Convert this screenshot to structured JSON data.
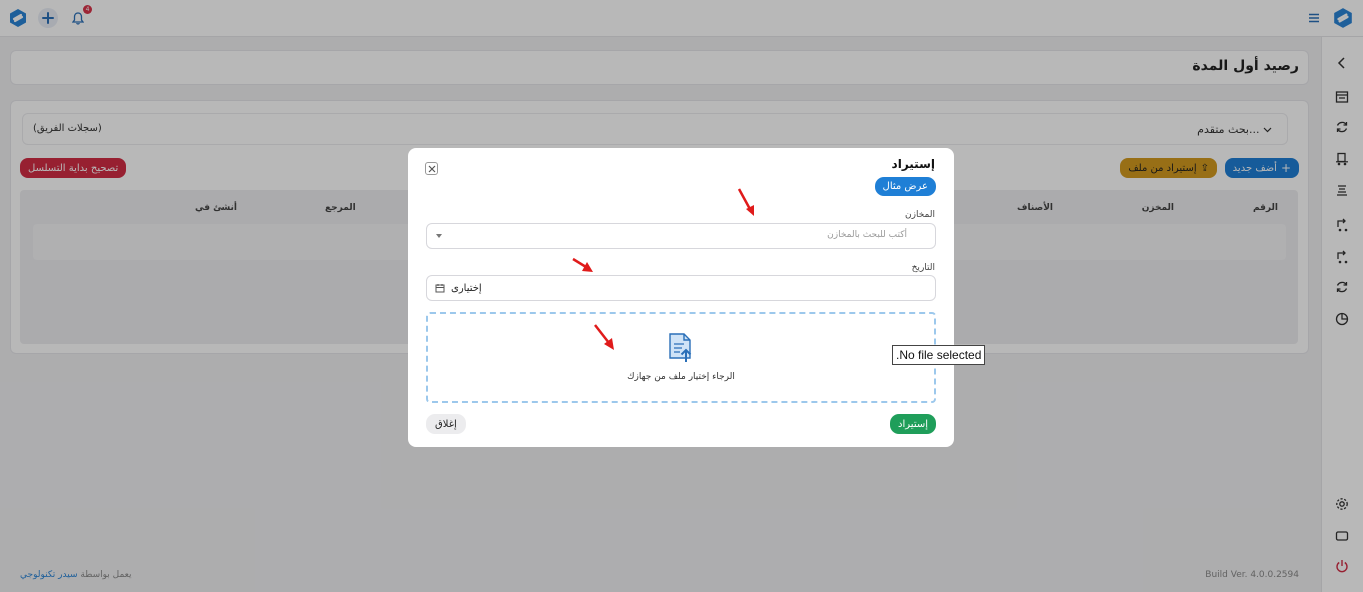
{
  "header": {
    "notification_count": "4",
    "brand_color": "#2a84d6"
  },
  "page": {
    "title": "رصيد أول المدة"
  },
  "toolbar": {
    "advanced_search": "بحث متقدم...",
    "team_records": "(سجلات الفريق)",
    "add_new": "أضف جديد",
    "import_from_file": "إستيراد من ملف",
    "fix_sequence_start": "تصحيح بداية التسلسل"
  },
  "table": {
    "columns": [
      "الرقم",
      "المخزن",
      "الأصناف",
      "المرجع",
      "أنشئ في"
    ]
  },
  "footer": {
    "powered_by": "يعمل بواسطة",
    "company": "سيدر تكنولوجي",
    "build_version": "Build Ver. 4.0.0.2594"
  },
  "modal": {
    "title": "إستيراد",
    "show_sample": "عرض مثال",
    "warehouses_label": "المخازن",
    "warehouses_placeholder": "أكتب للبحث بالمخازن",
    "date_label": "التاريخ",
    "date_value": "إختيارى",
    "dropzone_text": "الرجاء إختيار ملف من جهازك",
    "import_button": "إستيراد",
    "close_button": "إغلاق"
  },
  "tooltip": {
    "text": "No file selected."
  },
  "colors": {
    "primary_blue": "#1f7fd6",
    "import_orange": "#d39a1f",
    "danger_red": "#d12d45",
    "success_green": "#1f9e5a",
    "annotation_red": "#e01b1b"
  }
}
